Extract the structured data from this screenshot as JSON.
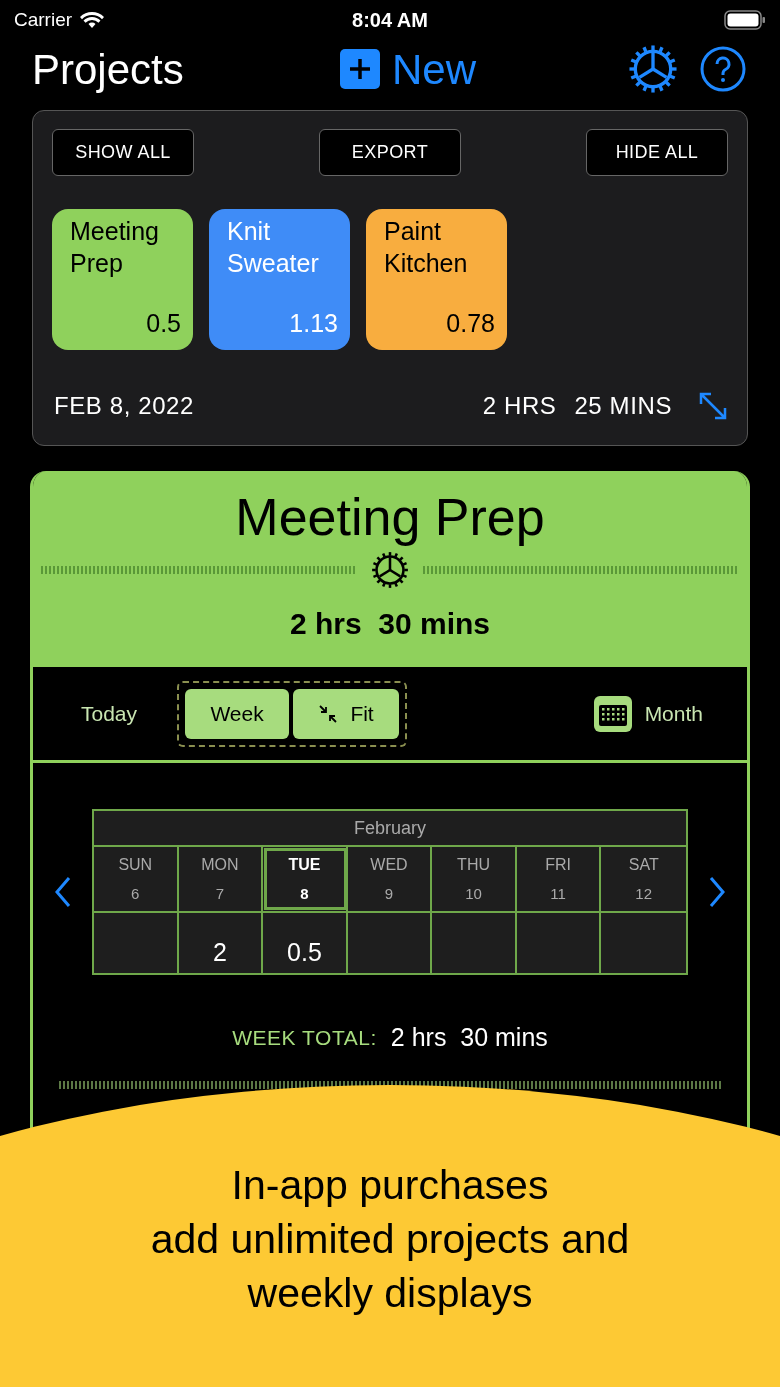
{
  "status_bar": {
    "carrier": "Carrier",
    "time": "8:04 AM"
  },
  "header": {
    "title": "Projects",
    "new_button": "New"
  },
  "summary": {
    "buttons": [
      "SHOW ALL",
      "EXPORT",
      "HIDE ALL"
    ],
    "projects": [
      {
        "name": "Meeting Prep",
        "value": "0.5",
        "color": "#8fd15c"
      },
      {
        "name": "Knit Sweater",
        "value": "1.13",
        "color": "#3f8cf7"
      },
      {
        "name": "Paint Kitchen",
        "value": "0.78",
        "color": "#f8ad3f"
      }
    ],
    "date": "FEB 8, 2022",
    "hours": "2 HRS",
    "minutes": "25 MINS"
  },
  "project": {
    "title": "Meeting Prep",
    "total": "2 hrs  30 mins",
    "views": [
      {
        "label": "Today",
        "kind": "text",
        "selected": false
      },
      {
        "label": "Week",
        "kind": "pill",
        "selected": true
      },
      {
        "label": "Fit",
        "kind": "fit",
        "selected": true
      },
      {
        "label": "Month",
        "kind": "calendar",
        "selected": false
      }
    ],
    "calendar": {
      "month": "February",
      "days": [
        {
          "day": "SUN",
          "date": "6",
          "selected": false
        },
        {
          "day": "MON",
          "date": "7",
          "value": "2",
          "selected": false
        },
        {
          "day": "TUE",
          "date": "8",
          "value": "0.5",
          "selected": true
        },
        {
          "day": "WED",
          "date": "9",
          "selected": false
        },
        {
          "day": "THU",
          "date": "10",
          "selected": false
        },
        {
          "day": "FRI",
          "date": "11",
          "selected": false
        },
        {
          "day": "SAT",
          "date": "12",
          "selected": false
        }
      ]
    },
    "week_total_label": "WEEK TOTAL:",
    "week_total": "2 hrs  30 mins"
  },
  "promo": [
    "In-app purchases",
    "add unlimited projects and",
    "weekly displays"
  ]
}
